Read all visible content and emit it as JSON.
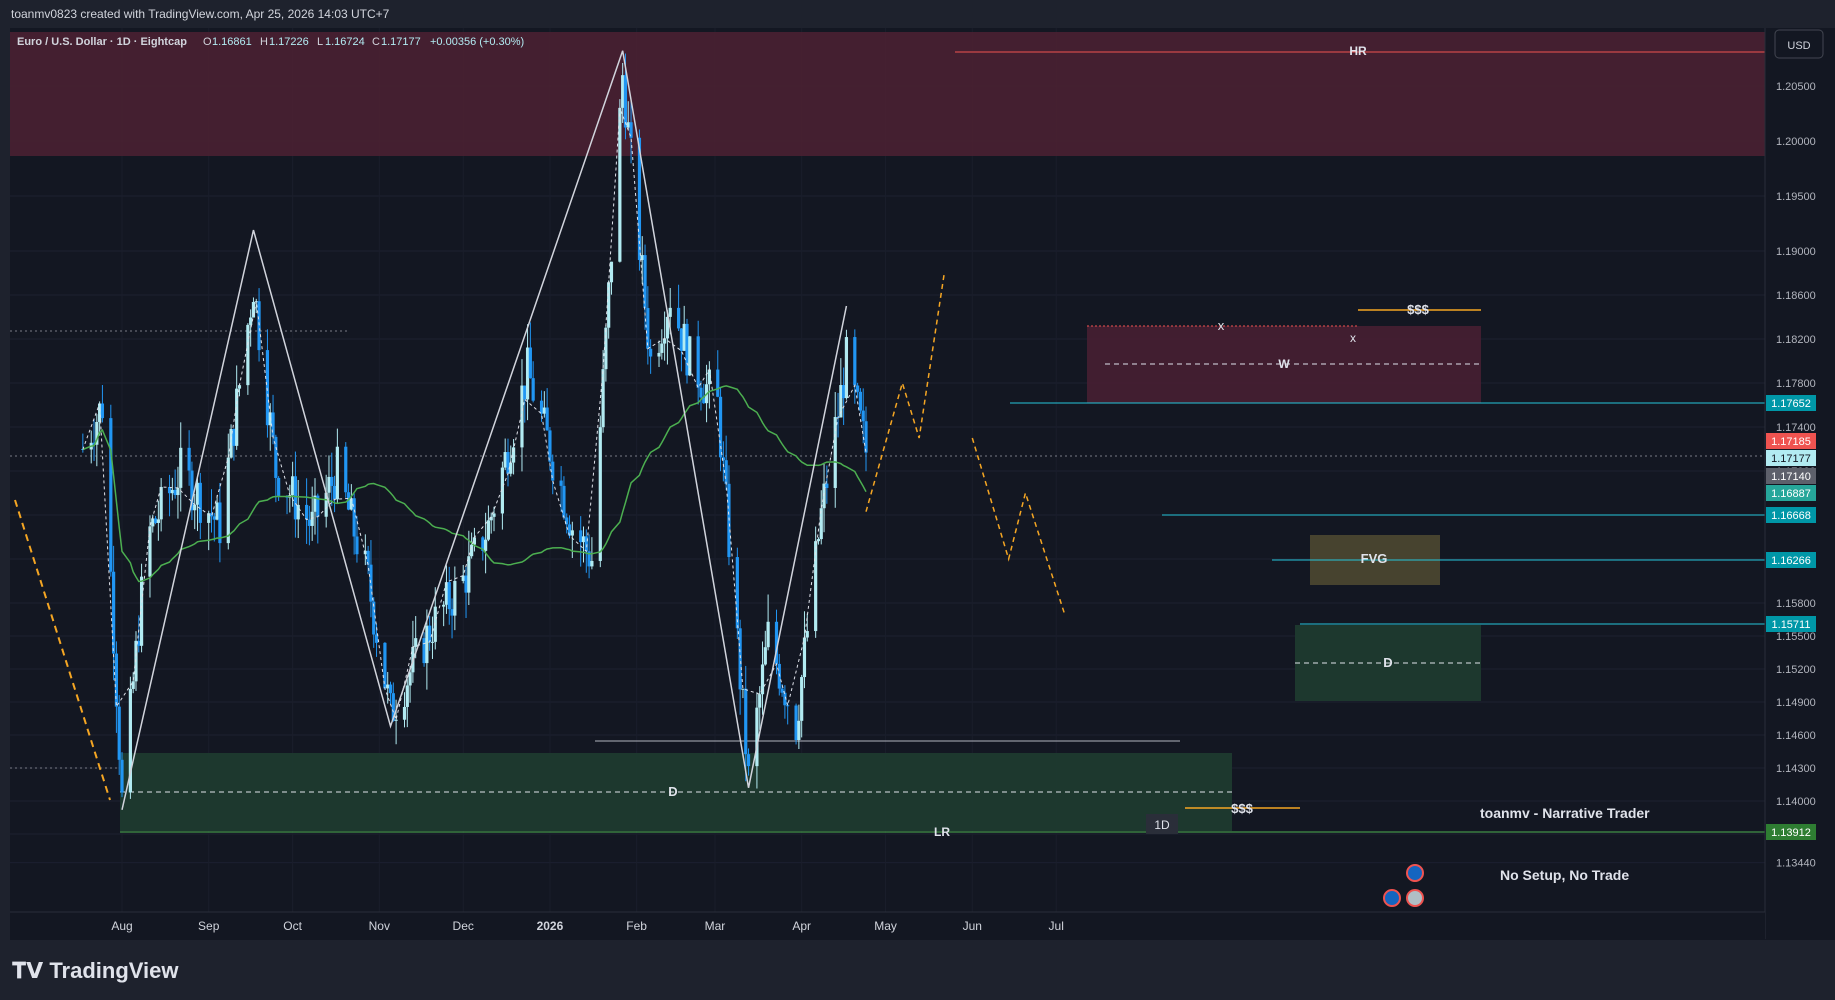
{
  "header": {
    "credit": "toanmv0823 created with TradingView.com, Apr 25, 2026 14:03 UTC+7",
    "symbol": "Euro / U.S. Dollar · 1D · Eightcap",
    "ohlc_open_label": "O",
    "ohlc_open": "1.16861",
    "ohlc_high_label": "H",
    "ohlc_high": "1.17226",
    "ohlc_low_label": "L",
    "ohlc_low": "1.16724",
    "ohlc_close_label": "C",
    "ohlc_close": "1.17177",
    "ohlc_change": "+0.00356 (+0.30%)",
    "currency": "USD"
  },
  "brand": "TradingView",
  "colors": {
    "background": "#131722",
    "bull": "#b2ebf2",
    "bear": "#2196f3",
    "ma": "#4caf50",
    "premium_zone": "#4a2032",
    "discount_zone": "#1e3a2f",
    "projection": "#f5a623",
    "level_line": "#26c6da",
    "current_price": "#ef5350"
  },
  "annotations": {
    "hr": "HR",
    "lr": "LR",
    "x1": "x",
    "x2": "x",
    "w": "W",
    "d_big": "D",
    "d_small": "D",
    "fvg": "FVG",
    "liq_high": "$$$",
    "liq_low": "$$$",
    "tf": "1D",
    "author": "toanmv - Narrative Trader",
    "motto": "No Setup, No Trade"
  },
  "chart_data": {
    "type": "candlestick",
    "symbol": "EURUSD",
    "timeframe": "1D",
    "x_tick_labels": [
      "Aug",
      "Sep",
      "Oct",
      "Nov",
      "Dec",
      "2026",
      "Feb",
      "Mar",
      "Apr",
      "May",
      "Jun",
      "Jul"
    ],
    "x_range": [
      "2025-07-18",
      "2026-07-20"
    ],
    "ylim": [
      1.132,
      1.21
    ],
    "y_tick_labels": [
      1.205,
      1.2,
      1.195,
      1.19,
      1.186,
      1.182,
      1.178,
      1.174,
      1.17,
      1.166,
      1.162,
      1.158,
      1.155,
      1.152,
      1.149,
      1.146,
      1.143,
      1.14,
      1.137,
      1.1344
    ],
    "price_labels": [
      {
        "value": "1.17652",
        "kind": "level"
      },
      {
        "value": "1.17185",
        "kind": "current"
      },
      {
        "value": "1.17177",
        "kind": "last"
      },
      {
        "value": "1.17140",
        "kind": "level"
      },
      {
        "value": "1.16887",
        "kind": "ma"
      },
      {
        "value": "1.16668",
        "kind": "level"
      },
      {
        "value": "1.16266",
        "kind": "level"
      },
      {
        "value": "1.15711",
        "kind": "level"
      },
      {
        "value": "1.13912",
        "kind": "level"
      }
    ],
    "last_candle": {
      "open": 1.16861,
      "high": 1.17226,
      "low": 1.16724,
      "close": 1.17177
    },
    "swing_path": [
      {
        "date": "2025-08-01",
        "price": 1.1392
      },
      {
        "date": "2025-09-17",
        "price": 1.1919
      },
      {
        "date": "2025-11-05",
        "price": 1.1468
      },
      {
        "date": "2026-01-27",
        "price": 1.2082
      },
      {
        "date": "2026-03-13",
        "price": 1.1412
      },
      {
        "date": "2026-04-17",
        "price": 1.185
      }
    ],
    "projection_path": [
      {
        "date": "2026-04-24",
        "price": 1.1663
      },
      {
        "date": "2026-05-07",
        "price": 1.178
      },
      {
        "date": "2026-05-13",
        "price": 1.173
      },
      {
        "date": "2026-05-22",
        "price": 1.188
      }
    ],
    "projection_path_2": [
      {
        "date": "2026-06-01",
        "price": 1.173
      },
      {
        "date": "2026-06-14",
        "price": 1.162
      },
      {
        "date": "2026-06-20",
        "price": 1.168
      },
      {
        "date": "2026-07-04",
        "price": 1.157
      }
    ],
    "zones": [
      {
        "name": "premium (HR)",
        "from": 1.199,
        "to": 1.209
      },
      {
        "name": "supply W",
        "from": 1.1766,
        "to": 1.1834
      },
      {
        "name": "FVG",
        "from": 1.1605,
        "to": 1.165
      },
      {
        "name": "demand D (small)",
        "from": 1.1505,
        "to": 1.1571
      },
      {
        "name": "demand D (large)",
        "from": 1.1392,
        "to": 1.146
      }
    ]
  }
}
